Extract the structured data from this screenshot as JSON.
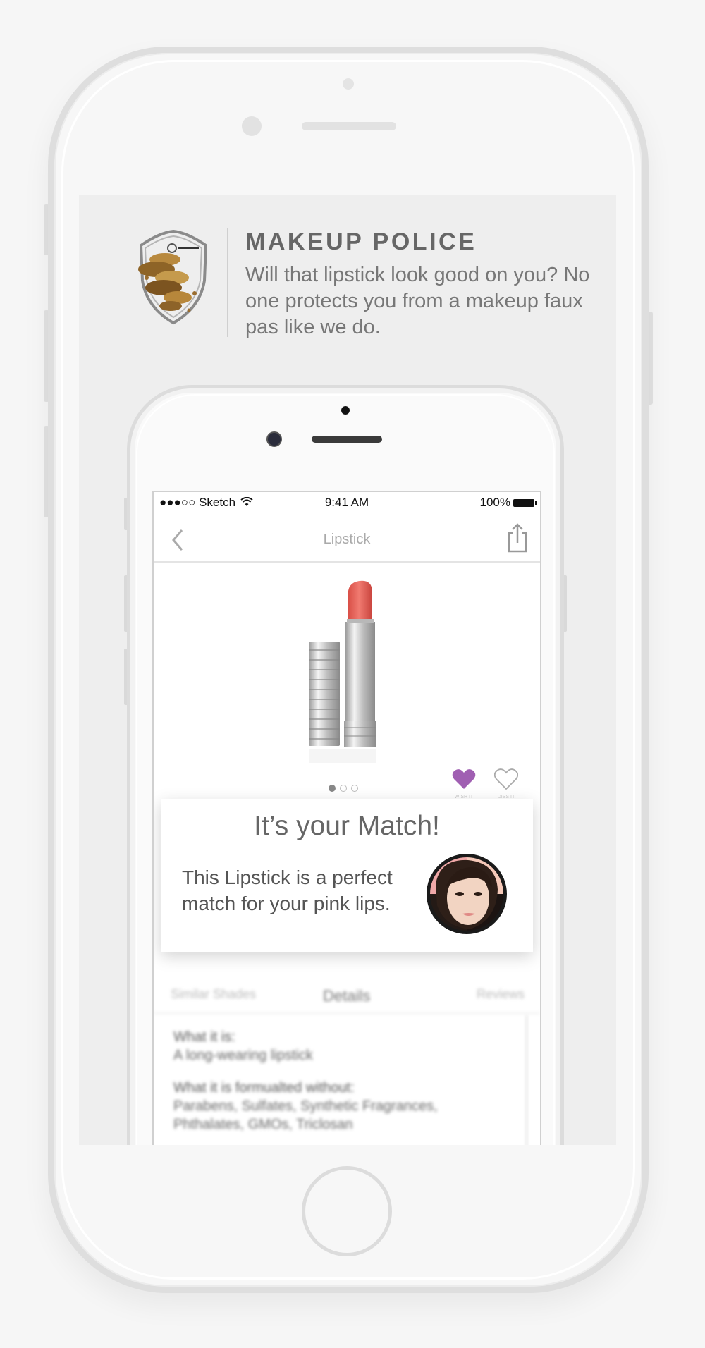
{
  "app": {
    "title": "MAKEUP POLICE",
    "tagline": "Will that lipstick look good on you? No one protects you from a makeup faux pas like we do."
  },
  "status_bar": {
    "carrier": "●●●○○ Sketch",
    "time": "9:41 AM",
    "battery": "100%"
  },
  "nav": {
    "title": "Lipstick"
  },
  "product": {
    "carousel_pages": 3,
    "active_page": 1,
    "wish_label": "WISH IT",
    "diss_label": "DISS IT",
    "wish_color": "#a05fb2"
  },
  "match": {
    "title": "It’s your Match!",
    "message": "This Lipstick is a perfect match for your pink lips."
  },
  "tabs": [
    "Similar Shades",
    "Details",
    "Reviews"
  ],
  "active_tab": "Details",
  "details": {
    "what_it_is_label": "What it is:",
    "what_it_is_value": "A long-wearing lipstick",
    "formulated_without_label": "What it is formualted without:",
    "formulated_without_value": "Parabens, Sulfates, Synthetic Fragrances, Phthalates, GMOs, Triclosan"
  },
  "colors": {
    "lipstick": "#e8635b",
    "page_bg": "#f6f6f6",
    "screen_bg": "#eeeeee"
  }
}
